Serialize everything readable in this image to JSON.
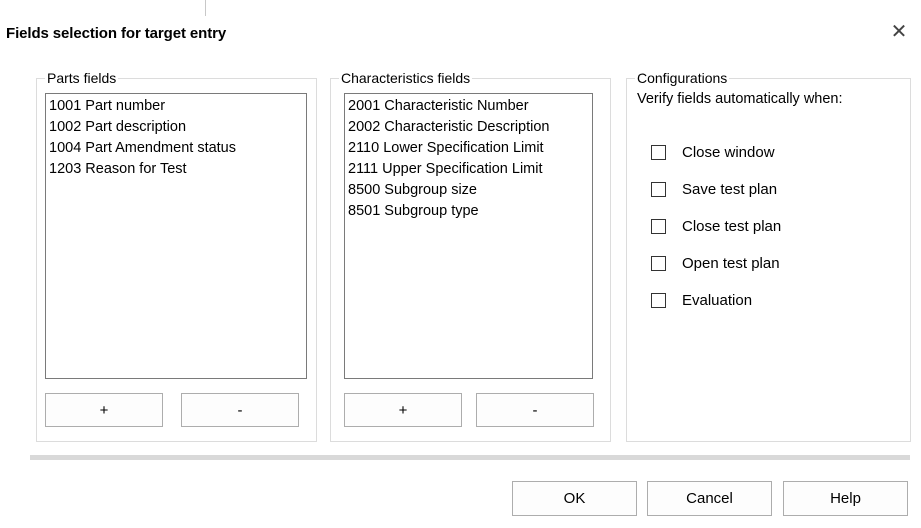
{
  "dialog": {
    "title": "Fields selection for target entry",
    "close_glyph": "✕"
  },
  "parts": {
    "legend": "Parts fields",
    "items": [
      "1001 Part number",
      "1002 Part description",
      "1004 Part Amendment status",
      "1203 Reason for Test"
    ],
    "add_label": "+",
    "remove_label": "-"
  },
  "characteristics": {
    "legend": "Characteristics fields",
    "items": [
      "2001 Characteristic Number",
      "2002 Characteristic Description",
      "2110 Lower Specification Limit",
      "2111 Upper Specification Limit",
      "8500 Subgroup size",
      "8501 Subgroup type"
    ],
    "add_label": "+",
    "remove_label": "-"
  },
  "configurations": {
    "legend": "Configurations",
    "label": "Verify fields automatically when:",
    "options": [
      {
        "label": "Close window",
        "checked": false
      },
      {
        "label": "Save test plan",
        "checked": false
      },
      {
        "label": "Close test plan",
        "checked": false
      },
      {
        "label": "Open test plan",
        "checked": false
      },
      {
        "label": "Evaluation",
        "checked": false
      }
    ]
  },
  "footer": {
    "ok_label": "OK",
    "cancel_label": "Cancel",
    "help_label": "Help"
  }
}
